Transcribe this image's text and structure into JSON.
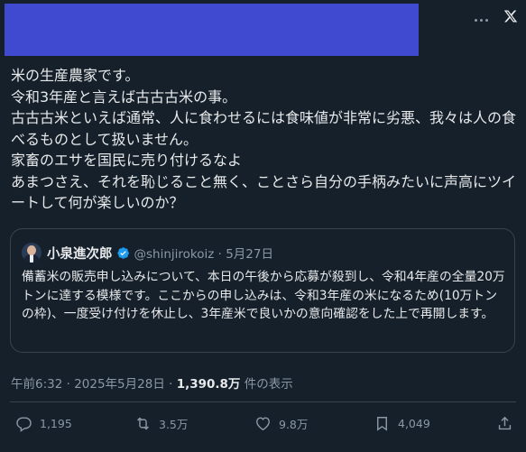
{
  "post": {
    "text": "米の生産農家です。\n令和3年産と言えば古古古米の事。\n古古古米といえば通常、人に食わせるには食味値が非常に劣悪、我々は人の食べるものとして扱いません。\n家畜のエサを国民に売り付けるなよ\nあまつさえ、それを恥じること無く、ことさら自分の手柄みたいに声高にツイートして何が楽しいのか？",
    "time": "午前6:32 · 2025年5月28日 · ",
    "views_count": "1,390.8万",
    "views_label": " 件の表示"
  },
  "quote": {
    "name": "小泉進次郎",
    "handle_date": "@shinjirokoiz · 5月27日",
    "text": "備蓄米の販売申し込みについて、本日の午後から応募が殺到し、令和4年産の全量20万トンに達する模様です。ここからの申し込みは、令和3年産の米になるため(10万トンの枠)、一度受け付けを休止し、3年産米で良いかの意向確認をした上で再開します。"
  },
  "actions": {
    "replies": "1,195",
    "reposts": "3.5万",
    "likes": "9.8万",
    "bookmarks": "4,049"
  },
  "colors": {
    "background": "#15202b",
    "redaction": "#3f4ad1",
    "verified": "#1d9bf0",
    "muted": "#8b98a5"
  }
}
